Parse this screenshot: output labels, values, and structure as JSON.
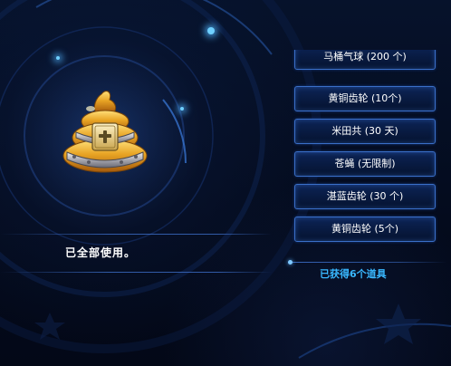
{
  "status": {
    "message": "已全部使用。"
  },
  "rewards": {
    "items": [
      {
        "label": "马桶气球 (200 个)"
      },
      {
        "label": "黄铜齿轮 (10个)"
      },
      {
        "label": "米田共 (30 天)"
      },
      {
        "label": "苍蝇 (无限制)"
      },
      {
        "label": "湛蓝齿轮 (30 个)"
      },
      {
        "label": "黄铜齿轮 (5个)"
      }
    ]
  },
  "summary": {
    "obtained_text": "已获得6个道具"
  },
  "colors": {
    "background": "#050a1a",
    "button_border": "#3a6fc8",
    "button_fill": "#0d2456",
    "accent_text": "#39b8ff",
    "item_gold": "#e0a020"
  },
  "icons": {
    "item": "golden-poop-lock-icon"
  }
}
